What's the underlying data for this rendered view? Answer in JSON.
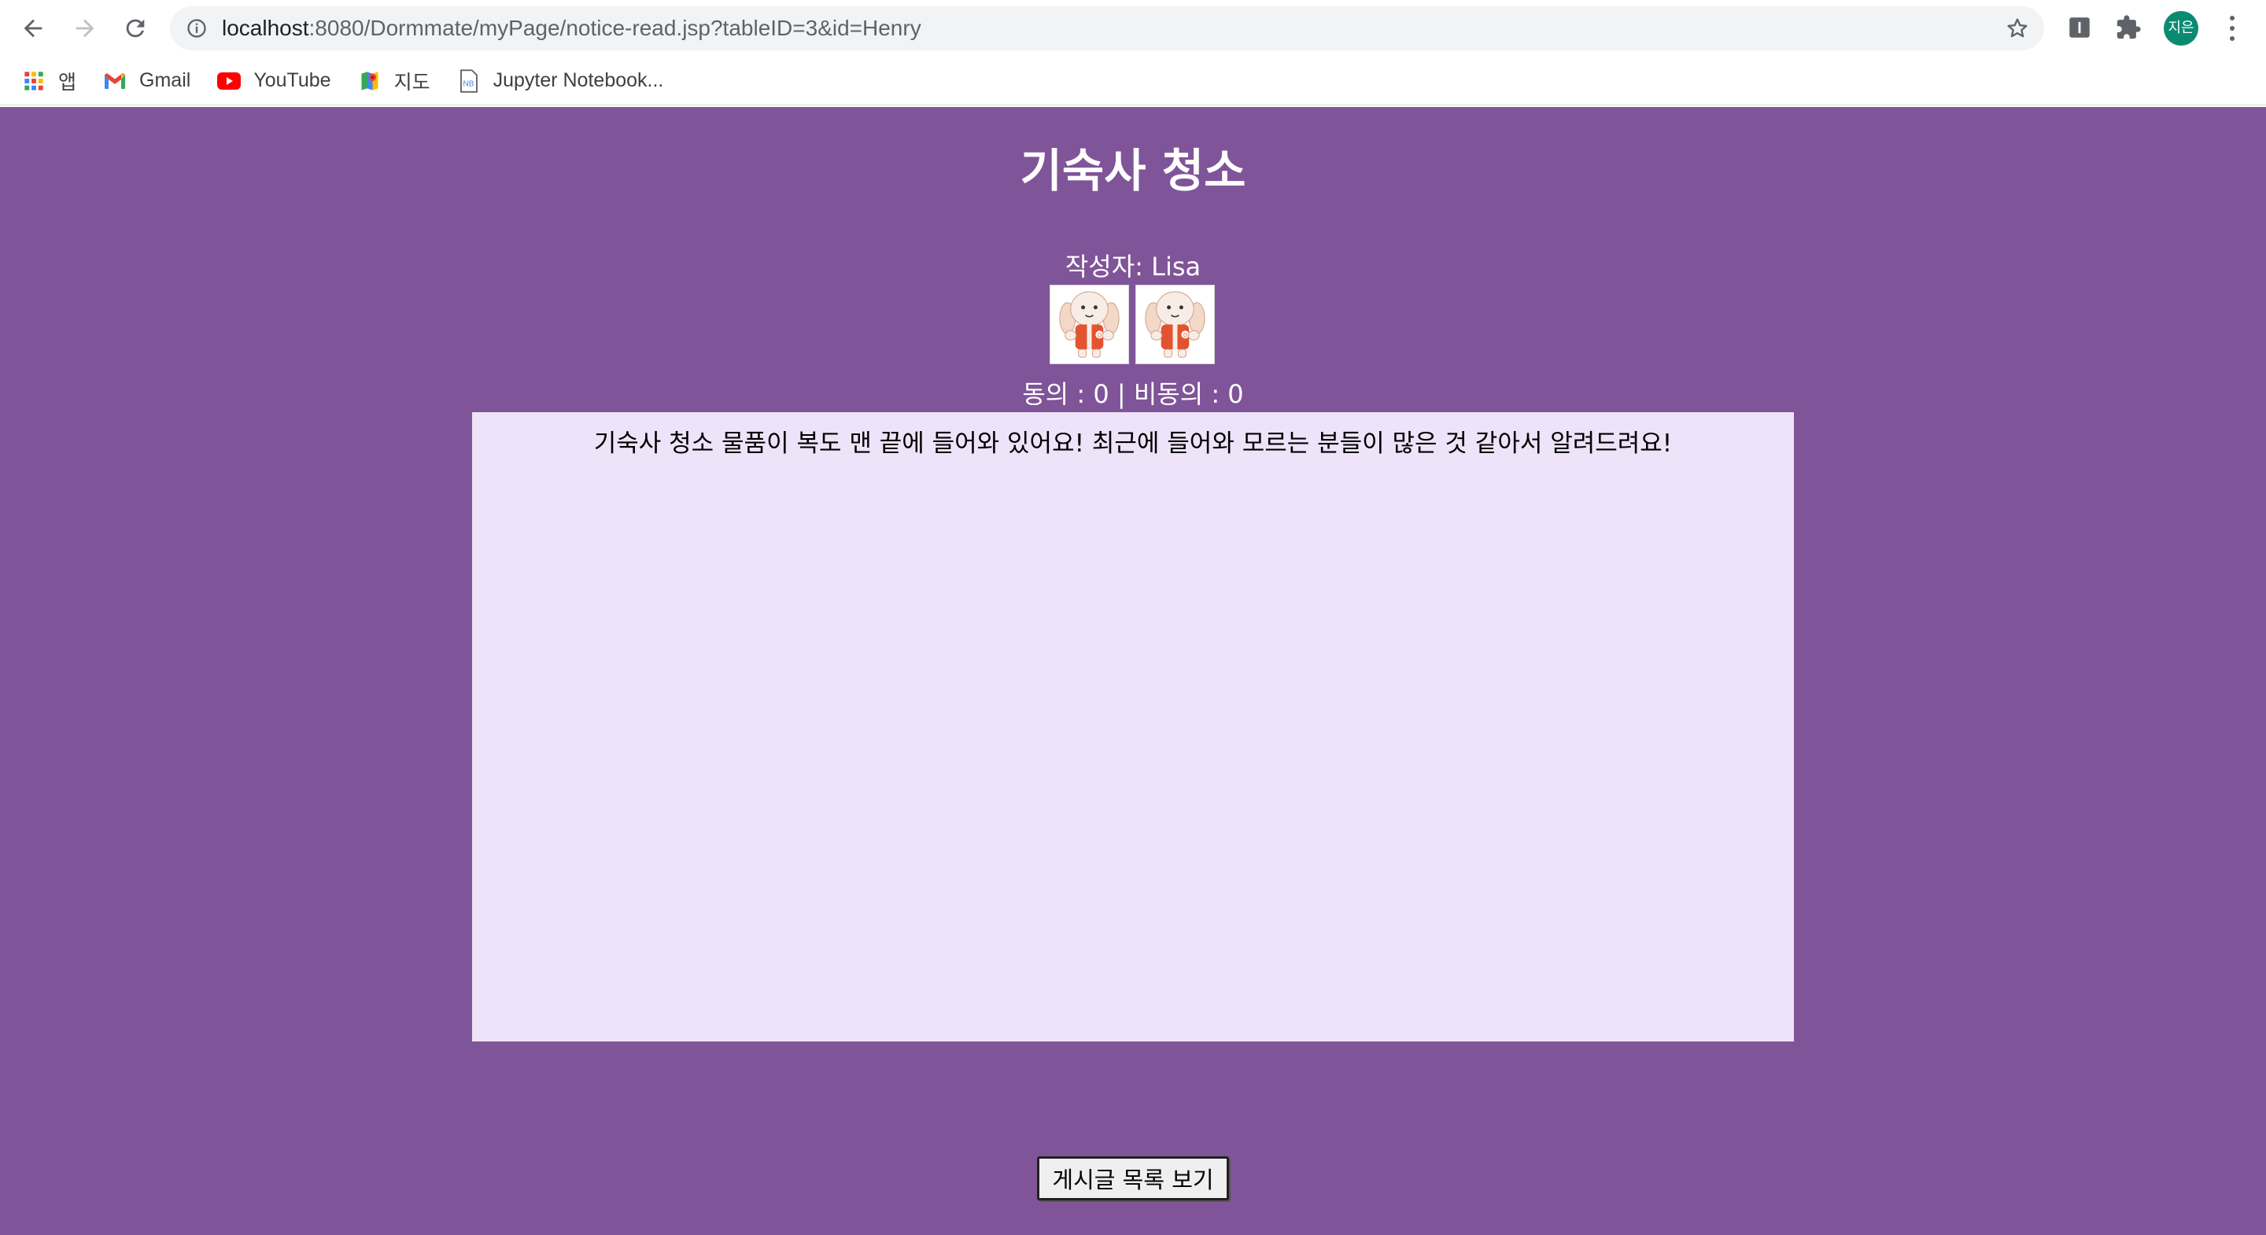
{
  "browser": {
    "url_host": "localhost",
    "url_path": ":8080/Dormmate/myPage/notice-read.jsp?tableID=3&id=Henry",
    "profile_label": "지은",
    "bookmarks": [
      {
        "label": "앱",
        "icon": "apps-grid-icon"
      },
      {
        "label": "Gmail",
        "icon": "gmail-icon"
      },
      {
        "label": "YouTube",
        "icon": "youtube-icon"
      },
      {
        "label": "지도",
        "icon": "maps-icon"
      },
      {
        "label": "Jupyter Notebook...",
        "icon": "notebook-icon"
      }
    ]
  },
  "post": {
    "title": "기숙사 청소",
    "author": "작성자: Lisa",
    "votes": "동의 : 0 | 비동의 : 0",
    "content": "기숙사 청소 물품이 복도 맨 끝에 들어와 있어요! 최근에 들어와 모르는 분들이 많은 것 같아서 알려드려요!",
    "images": [
      "mascot-image",
      "mascot-image"
    ]
  },
  "actions": {
    "list_button_label": "게시글 목록 보기"
  },
  "colors": {
    "page_background": "#805498",
    "content_background": "#eee3f8",
    "profile_avatar": "#0b8a72"
  }
}
